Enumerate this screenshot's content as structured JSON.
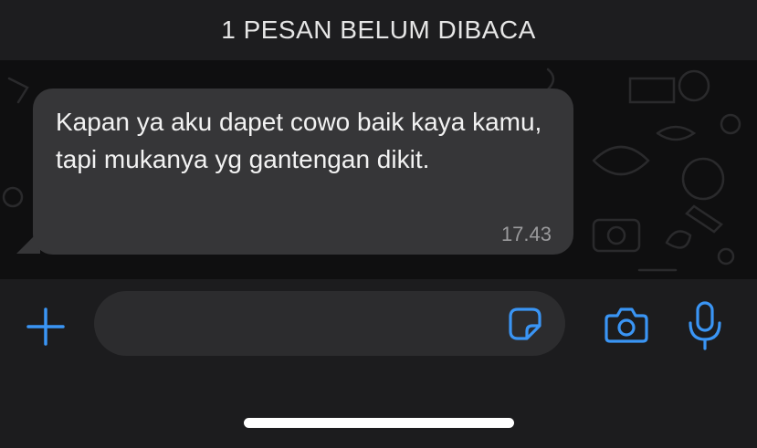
{
  "banner": {
    "text": "1 PESAN BELUM DIBACA"
  },
  "message": {
    "text": "Kapan ya aku dapet cowo baik kaya kamu, tapi mukanya yg gantengan dikit.",
    "time": "17.43"
  },
  "composer": {
    "input_value": "",
    "icons": {
      "attach": "plus-icon",
      "sticker": "sticker-icon",
      "camera": "camera-icon",
      "mic": "microphone-icon"
    }
  },
  "colors": {
    "accent": "#3a95f5",
    "bubble": "#363638",
    "banner": "#1d1d1f",
    "composer": "#1c1c1e"
  }
}
